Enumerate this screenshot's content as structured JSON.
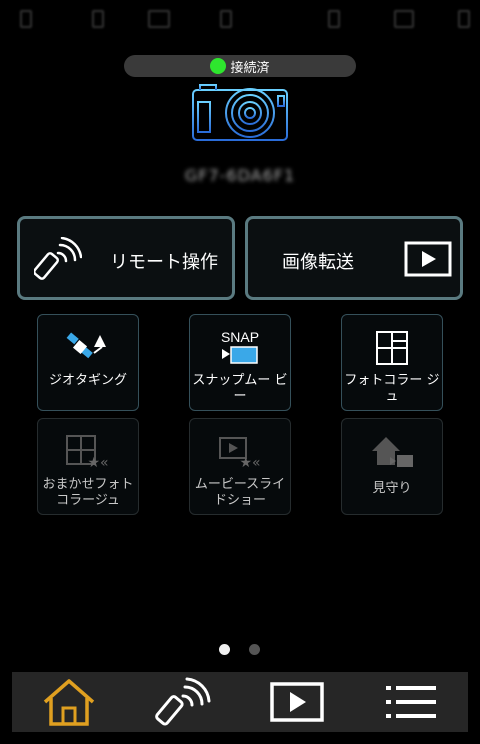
{
  "status": {
    "connection_label": "接続済",
    "connection_color": "#2ee62e"
  },
  "camera": {
    "name": "GF7-6DA6F1"
  },
  "buttons": {
    "remote": "リモート操作",
    "transfer": "画像転送"
  },
  "tiles": [
    {
      "label": "ジオタギング",
      "enabled": true
    },
    {
      "label": "スナップムー ビー",
      "enabled": true
    },
    {
      "label": "フォトコラー ジュ",
      "enabled": true
    },
    {
      "label": "おまかせフォト コラージュ",
      "enabled": false
    },
    {
      "label": "ムービースライ ドショー",
      "enabled": false
    },
    {
      "label": "見守り",
      "enabled": false
    }
  ],
  "snap_icon_text": "SNAP",
  "pager": {
    "current": 1,
    "total": 2
  },
  "colors": {
    "accent": "#e0a020",
    "tile_border": "#35505a",
    "icon_blue": "#3aa8e8"
  }
}
